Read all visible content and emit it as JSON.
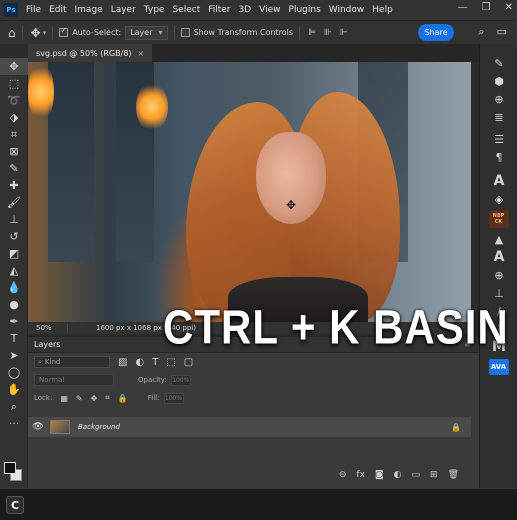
{
  "app": {
    "logo": "Ps"
  },
  "menu": [
    "File",
    "Edit",
    "Image",
    "Layer",
    "Type",
    "Select",
    "Filter",
    "3D",
    "View",
    "Plugins",
    "Window",
    "Help"
  ],
  "window_controls": {
    "minimize": "—",
    "restore": "❐",
    "close": "✕"
  },
  "options": {
    "auto_select_label": "Auto-Select:",
    "auto_select_checked": true,
    "auto_select_value": "Layer",
    "show_transform_label": "Show Transform Controls",
    "show_transform_checked": false,
    "share_label": "Share"
  },
  "document": {
    "tab_title": "svg.psd @ 50% (RGB/8)",
    "close": "×",
    "zoom": "50%",
    "dimensions": "1600 px x 1068 px (240 ppi)"
  },
  "overlay_text": "CTRL + K BASIN",
  "layers_panel": {
    "title": "Layers",
    "kind_placeholder": "Kind",
    "blend_mode": "Normal",
    "opacity_label": "Opacity:",
    "opacity_value": "100%",
    "lock_label": "Lock:",
    "fill_label": "Fill:",
    "fill_value": "100%",
    "layer_name": "Background",
    "layer_visible": true,
    "layer_locked": true
  },
  "right_strip": {
    "nbp_label": "NBP CK",
    "ava_label": "AVA",
    "m_label": "M",
    "a_label": "A"
  },
  "colors": {
    "accent": "#1473e6",
    "panel": "#3a3a3a",
    "chrome": "#323232"
  }
}
